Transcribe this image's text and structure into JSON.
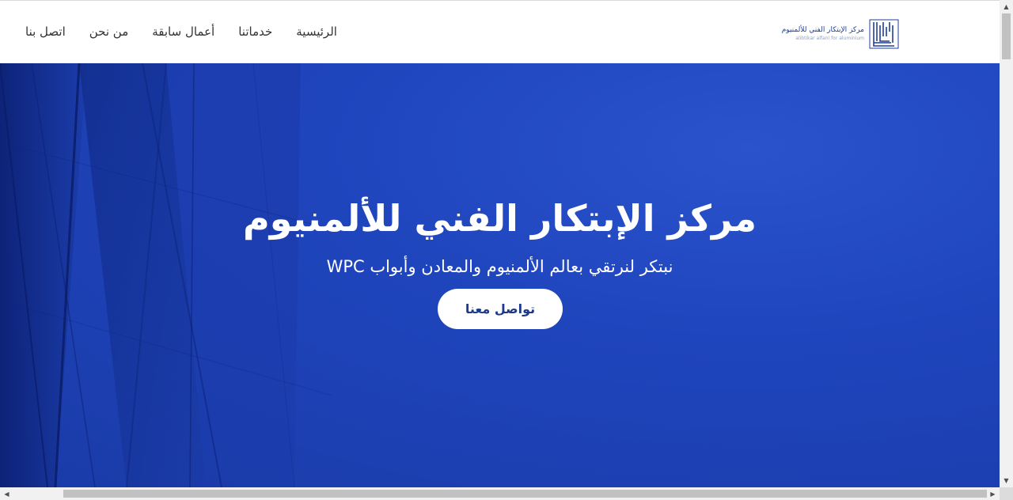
{
  "nav": {
    "items": [
      {
        "label": "الرئيسية"
      },
      {
        "label": "خدماتنا"
      },
      {
        "label": "أعمال سابقة"
      },
      {
        "label": "من نحن"
      },
      {
        "label": "اتصل بنا"
      }
    ]
  },
  "logo": {
    "name_ar": "مركز الإبتكار الفني للألمنيوم",
    "name_en": "alibtikar alfani for aluminium",
    "mark_icon": "kufic-logo-icon"
  },
  "hero": {
    "title": "مركز الإبتكار الفني للألمنيوم",
    "subtitle": "نبتكر لنرتقي بعالم الألمنيوم والمعادن وأبواب WPC",
    "cta_label": "تواصل معنا"
  },
  "colors": {
    "hero_blue": "#1f45bd",
    "brand_blue": "#1f3f9a",
    "button_text": "#1d3a8a"
  },
  "scrollbars": {
    "up_icon": "arrow-up-icon",
    "down_icon": "arrow-down-icon",
    "left_icon": "arrow-left-icon",
    "right_icon": "arrow-right-icon"
  }
}
